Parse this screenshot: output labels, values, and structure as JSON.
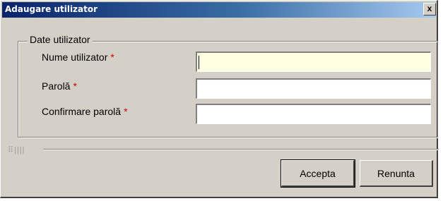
{
  "window": {
    "title": "Adaugare utilizator",
    "close_label": "x"
  },
  "form": {
    "group_label": "Date utilizator",
    "required_marker": "*",
    "fields": [
      {
        "label": "Nume utilizator",
        "value": "",
        "placeholder": ""
      },
      {
        "label": "Parolă",
        "value": "",
        "placeholder": ""
      },
      {
        "label": "Confirmare parolă",
        "value": "",
        "placeholder": ""
      }
    ]
  },
  "footer": {
    "grip": "⠿||||",
    "accept_label": "Accepta",
    "cancel_label": "Renunta"
  },
  "colors": {
    "title_gradient_start": "#0a246a",
    "focused_input": "#ffffe1",
    "required": "#cc0000",
    "dialog_bg": "#d4d0c8"
  }
}
